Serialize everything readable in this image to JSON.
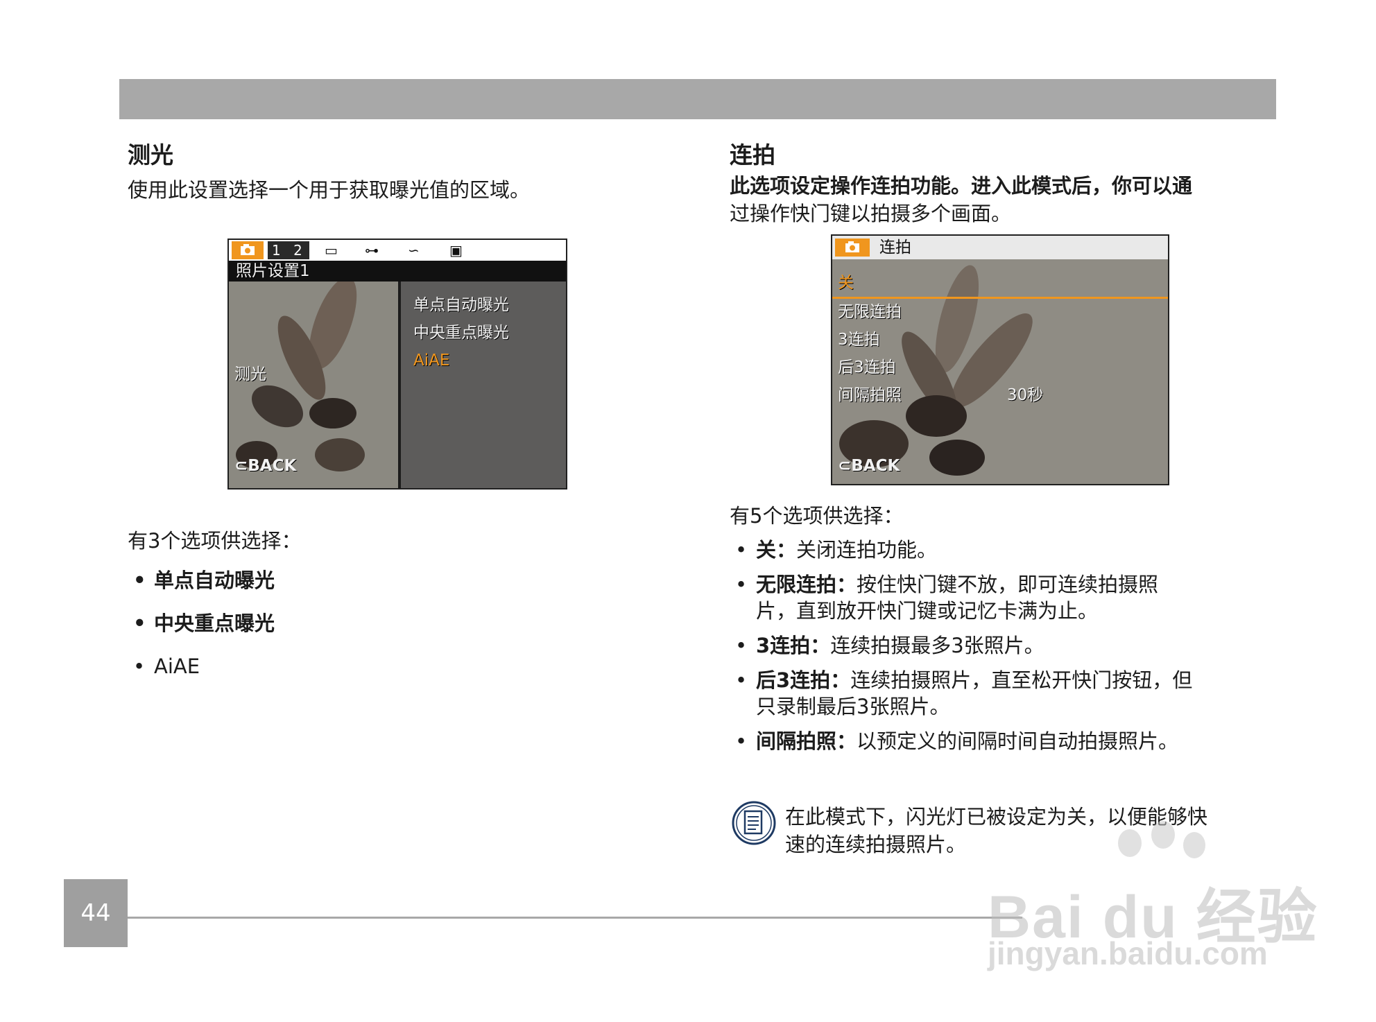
{
  "left": {
    "heading": "测光",
    "description": "使用此设置选择一个用于获取曝光值的区域。",
    "screen": {
      "tab_numbers": "1 2",
      "subtitle": "照片设置1",
      "item_label": "测光",
      "menu": [
        "单点自动曝光",
        "中央重点曝光",
        "AiAE"
      ],
      "back": "BACK"
    },
    "options_intro": "有3个选项供选择：",
    "options": [
      "单点自动曝光",
      "中央重点曝光",
      "AiAE"
    ]
  },
  "right": {
    "heading": "连拍",
    "description_bold": "此选项设定操作连拍功能。进入此模式后，你可以通",
    "description_rest": "过操作快门键以拍摄多个画面。",
    "screen": {
      "title": "连拍",
      "menu": [
        "关",
        "无限连拍",
        "3连拍",
        "后3连拍",
        "间隔拍照"
      ],
      "interval_value": "30秒",
      "back": "BACK"
    },
    "options_intro": "有5个选项供选择：",
    "options": [
      {
        "term": "关：",
        "desc": "关闭连拍功能。"
      },
      {
        "term": "无限连拍：",
        "desc": "按住快门键不放，即可连续拍摄照",
        "desc2": "片，直到放开快门键或记忆卡满为止。"
      },
      {
        "term": "3连拍：",
        "desc": "连续拍摄最多3张照片。"
      },
      {
        "term": "后3连拍：",
        "desc": "连续拍摄照片，直至松开快门按钮，但",
        "desc2": "只录制最后3张照片。"
      },
      {
        "term": "间隔拍照：",
        "desc": "以预定义的间隔时间自动拍摄照片。"
      }
    ],
    "note_line1": "在此模式下，闪光灯已被设定为关，以便能够快",
    "note_line2": "速的连续拍摄照片。"
  },
  "page_number": "44",
  "watermark": {
    "logo": "Bai du 经验",
    "url": "jingyan.baidu.com"
  },
  "colors": {
    "accent_orange": "#f0961e",
    "bar_gray": "#a8a8a8"
  },
  "icons": [
    "camera-icon",
    "back-arrow-icon",
    "note-icon"
  ]
}
